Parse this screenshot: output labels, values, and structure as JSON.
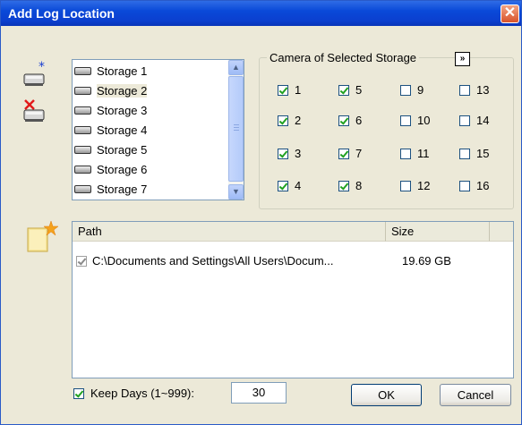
{
  "window": {
    "title": "Add Log Location",
    "close_glyph": "✕"
  },
  "storages": [
    "Storage 1",
    "Storage 2",
    "Storage 3",
    "Storage 4",
    "Storage 5",
    "Storage 6",
    "Storage 7"
  ],
  "selected_storage": "Storage 2",
  "camera_group": {
    "label": "Camera of Selected Storage",
    "more_glyph": "»",
    "cameras": [
      {
        "n": "1",
        "checked": true
      },
      {
        "n": "5",
        "checked": true
      },
      {
        "n": "9",
        "checked": false
      },
      {
        "n": "13",
        "checked": false
      },
      {
        "n": "2",
        "checked": true
      },
      {
        "n": "6",
        "checked": true
      },
      {
        "n": "10",
        "checked": false
      },
      {
        "n": "14",
        "checked": false
      },
      {
        "n": "3",
        "checked": true
      },
      {
        "n": "7",
        "checked": true
      },
      {
        "n": "11",
        "checked": false
      },
      {
        "n": "15",
        "checked": false
      },
      {
        "n": "4",
        "checked": true
      },
      {
        "n": "8",
        "checked": true
      },
      {
        "n": "12",
        "checked": false
      },
      {
        "n": "16",
        "checked": false
      }
    ]
  },
  "log_list": {
    "columns": {
      "path": "Path",
      "size": "Size"
    },
    "rows": [
      {
        "path": "C:\\Documents and Settings\\All Users\\Docum...",
        "size": "19.69 GB"
      }
    ]
  },
  "keep_days": {
    "label": "Keep Days (1~999):",
    "value": "30",
    "checked": true
  },
  "buttons": {
    "ok": "OK",
    "cancel": "Cancel"
  },
  "icons": {
    "add_storage": "add-storage-icon",
    "remove_storage": "remove-storage-icon",
    "new_folder": "new-folder-icon"
  },
  "colors": {
    "titlebar": "#0a49d8",
    "close": "#d8532b",
    "dialog_bg": "#ece9d8",
    "check": "#21a121"
  }
}
